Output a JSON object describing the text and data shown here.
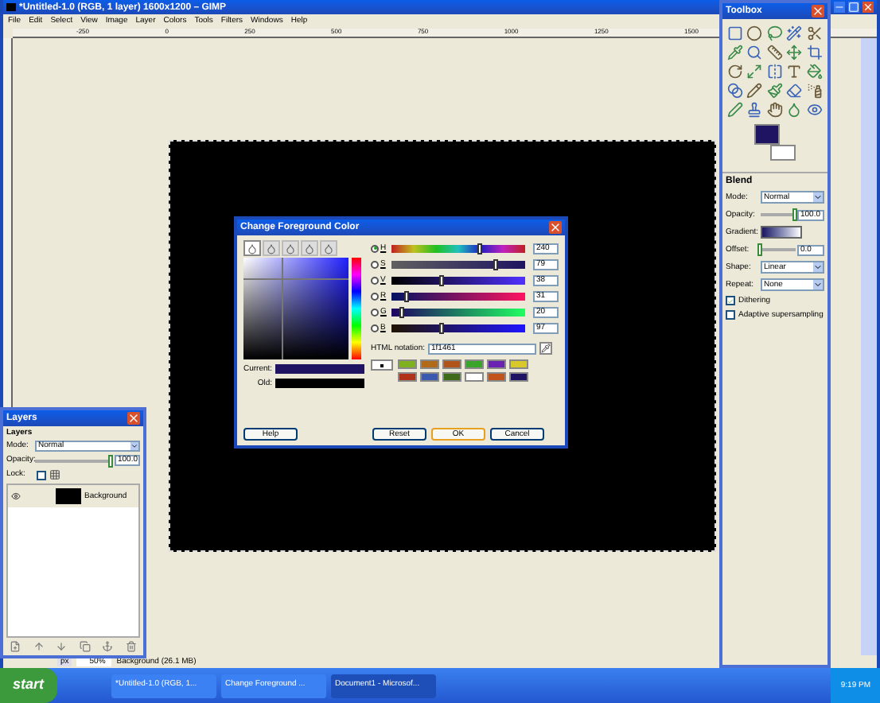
{
  "main_window": {
    "title": "*Untitled-1.0 (RGB, 1 layer) 1600x1200 – GIMP",
    "menu": [
      "File",
      "Edit",
      "Select",
      "View",
      "Image",
      "Layer",
      "Colors",
      "Tools",
      "Filters",
      "Windows",
      "Help"
    ],
    "ruler_labels": [
      "-250",
      "0",
      "250",
      "500",
      "750",
      "1000",
      "1250",
      "1500"
    ],
    "status": {
      "unit": "px",
      "zoom": "50%",
      "message": "Background (26.1 MB)"
    }
  },
  "toolbox": {
    "title": "Toolbox",
    "colors": [
      {
        "color": "#1f1461"
      },
      {
        "color": "#ffffff"
      }
    ],
    "options": {
      "title": "Blend",
      "fields": [
        {
          "kind": "select",
          "label": "Mode:",
          "value": "Normal"
        },
        {
          "kind": "slider",
          "label": "Opacity:",
          "value": "100.0",
          "level": 1
        },
        {
          "kind": "gradient",
          "label": "Gradient:"
        },
        {
          "kind": "slider",
          "label": "Offset:",
          "value": "0.0",
          "level": 0
        },
        {
          "kind": "select",
          "label": "Shape:",
          "value": "Linear"
        },
        {
          "kind": "select",
          "label": "Repeat:",
          "value": "None"
        }
      ],
      "checks": [
        {
          "label": "Dithering",
          "checked": true
        },
        {
          "label": "Adaptive supersampling",
          "checked": false
        }
      ]
    }
  },
  "layers": {
    "title": "Layers",
    "heading": "Layers",
    "mode": {
      "label": "Mode:",
      "value": "Normal"
    },
    "opacity": {
      "label": "Opacity:",
      "value": "100.0",
      "level": 1
    },
    "lock": {
      "label": "Lock:",
      "checked": false
    },
    "items": [
      {
        "name": "Background",
        "visible": true,
        "selected": true
      }
    ]
  },
  "dialog": {
    "title": "Change Foreground Color",
    "tabs": [
      {
        "selected": true
      },
      {
        "selected": false
      },
      {
        "selected": false
      },
      {
        "selected": false
      },
      {
        "selected": false
      }
    ],
    "channels": [
      {
        "label": "H",
        "value": "240",
        "level": 0.67,
        "selected": true
      },
      {
        "label": "S",
        "value": "79",
        "level": 0.79,
        "selected": false
      },
      {
        "label": "V",
        "value": "38",
        "level": 0.38,
        "selected": false
      },
      {
        "label": "R",
        "value": "31",
        "level": 0.12,
        "selected": false
      },
      {
        "label": "G",
        "value": "20",
        "level": 0.08,
        "selected": false
      },
      {
        "label": "B",
        "value": "97",
        "level": 0.38,
        "selected": false
      }
    ],
    "html_label": "HTML notation:",
    "html_value": "1f1461",
    "current": {
      "label": "Current:",
      "color": "#1f1461"
    },
    "old": {
      "label": "Old:",
      "color": "#000000"
    },
    "history": [
      {
        "color": "#7fb01f"
      },
      {
        "color": "#b06a1a"
      },
      {
        "color": "#b0541a"
      },
      {
        "color": "#3aa52a"
      },
      {
        "color": "#6a22b0"
      },
      {
        "color": "#d8c82a"
      },
      {
        "color": "#b0321a"
      },
      {
        "color": "#3a5ab0"
      },
      {
        "color": "#3f6a1a"
      },
      {
        "color": "#ffffff"
      },
      {
        "color": "#c0541a"
      },
      {
        "color": "#1f1461"
      }
    ],
    "buttons": [
      "Help",
      "Reset",
      "OK",
      "Cancel"
    ]
  },
  "taskbar": {
    "start": "start",
    "tasks": [
      {
        "label": "*Untitled-1.0 (RGB, 1...",
        "selected": false
      },
      {
        "label": "Change Foreground ...",
        "selected": false
      },
      {
        "label": "Document1 - Microsof...",
        "selected": true
      }
    ],
    "clock": "9:19 PM"
  }
}
